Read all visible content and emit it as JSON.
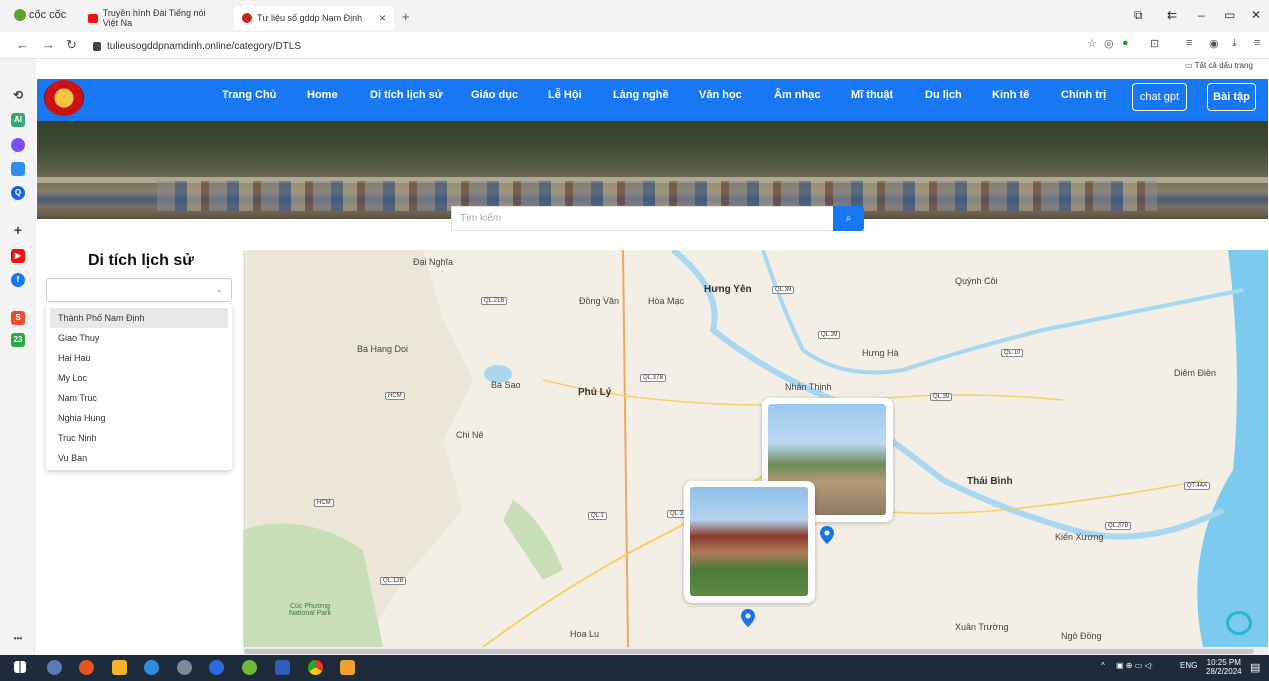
{
  "browser": {
    "brand": "cốc cốc",
    "tabs": [
      {
        "title": "Truyền hình Đài Tiếng nói Việt Na",
        "color": "#e11"
      },
      {
        "title": "Tư liệu số gddp Nam Định",
        "color": "#c22"
      }
    ],
    "new_tab": "+",
    "url": "tulieusogddpnamdinh.online/category/DTLS",
    "bookmarks_label": "Tất cả dấu trang"
  },
  "site": {
    "menu": [
      "Trang Chủ",
      "Home",
      "Di tích lịch sử",
      "Giáo dục",
      "Lễ Hội",
      "Làng nghề",
      "Văn học",
      "Âm nhạc",
      "Mĩ thuật",
      "Du lịch",
      "Kinh tế",
      "Chính trị"
    ],
    "chat_button": "chat gpt",
    "exercise_button": "Bài tập",
    "search_placeholder": "Tìm kiếm",
    "brand_color": "#1877f2"
  },
  "panel": {
    "title": "Di tích lịch sử",
    "select_value": "",
    "options": [
      "Thành Phố Nam Định",
      "Giao Thuy",
      "Hai Hau",
      "My Loc",
      "Nam Truc",
      "Nghia Hung",
      "Truc Ninh",
      "Vu Ban"
    ],
    "selected_index": 0
  },
  "map": {
    "places": [
      "Đại Nghĩa",
      "Đồng Văn",
      "Hòa Mạc",
      "Hưng Yên",
      "Quỳnh Côi",
      "Ba Hang Doi",
      "Hưng Hà",
      "Ba Sao",
      "Phủ Lý",
      "Nhân Thịnh",
      "Diêm Điền",
      "Chi Nê",
      "Thái Bình",
      "Kiến Xương",
      "Cúc Phương National Park",
      "Hoa Lu",
      "Xuân Trường",
      "Ngô Đồng"
    ],
    "road_shields": [
      "QL.21B",
      "QL.39",
      "QL.39",
      "QL.10",
      "QL.37B",
      "HCM",
      "QL.39",
      "HCM",
      "QL.1",
      "QL.3",
      "QL.12B",
      "QT.44A",
      "QL.37B"
    ]
  },
  "taskbar": {
    "time": "10:25 PM",
    "date": "28/2/2024",
    "lang": "ENG"
  }
}
